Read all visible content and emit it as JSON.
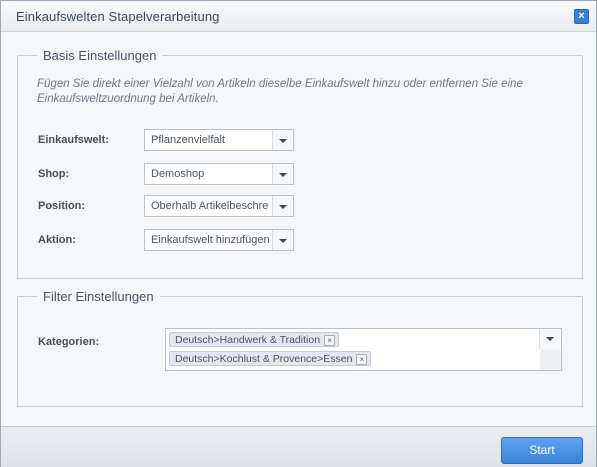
{
  "window": {
    "title": "Einkaufswelten Stapelverarbeitung",
    "close_icon": "close-icon"
  },
  "basis": {
    "legend": "Basis Einstellungen",
    "hint": "Fügen Sie direkt einer Vielzahl von Artikeln dieselbe Einkaufswelt hinzu oder entfernen Sie eine Einkaufsweltzuordnung bei Artikeln.",
    "fields": [
      {
        "label": "Einkaufswelt:",
        "value": "Pflanzenvielfalt"
      },
      {
        "label": "Shop:",
        "value": "Demoshop"
      },
      {
        "label": "Position:",
        "value": "Oberhalb Artikelbeschreibung"
      },
      {
        "label": "Aktion:",
        "value": "Einkaufswelt hinzufügen"
      }
    ]
  },
  "filter": {
    "legend": "Filter Einstellungen",
    "categories_label": "Kategorien:",
    "selected_categories": [
      "Deutsch>Handwerk & Tradition",
      "Deutsch>Kochlust & Provence>Essen"
    ]
  },
  "footer": {
    "start_label": "Start"
  },
  "colors": {
    "accent": "#3a83d8",
    "close_button": "#3a7fd5"
  }
}
